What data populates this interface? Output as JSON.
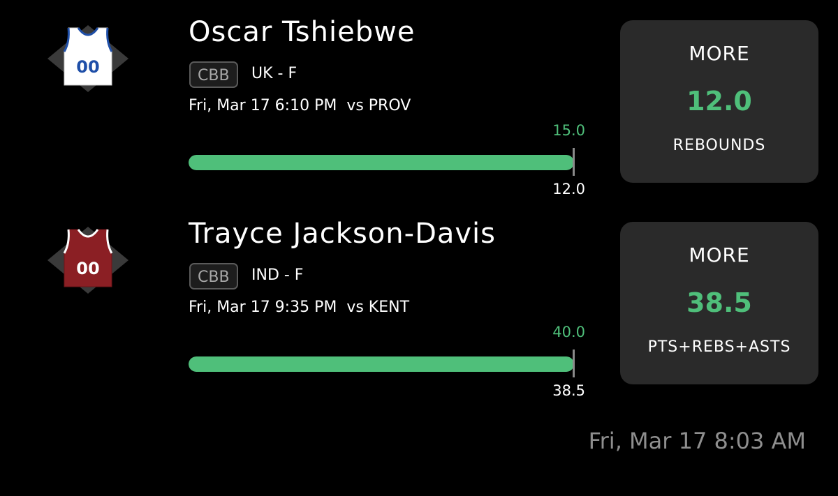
{
  "picks": [
    {
      "player_name": "Oscar Tshiebwe",
      "league": "CBB",
      "team_position": "UK - F",
      "game_info": "Fri, Mar 17 6:10 PM  vs PROV",
      "bar_top_value": "15.0",
      "bar_bottom_value": "12.0",
      "progress_fraction": 1.0,
      "jersey": {
        "number": "00",
        "body_color": "#ffffff",
        "trim_color": "#1f4fa8",
        "number_color": "#1f4fa8"
      },
      "card": {
        "direction": "MORE",
        "line": "12.0",
        "stat": "REBOUNDS"
      }
    },
    {
      "player_name": "Trayce Jackson-Davis",
      "league": "CBB",
      "team_position": "IND - F",
      "game_info": "Fri, Mar 17 9:35 PM  vs KENT",
      "bar_top_value": "40.0",
      "bar_bottom_value": "38.5",
      "progress_fraction": 1.0,
      "jersey": {
        "number": "00",
        "body_color": "#8b1f24",
        "trim_color": "#ffffff",
        "number_color": "#ffffff"
      },
      "card": {
        "direction": "MORE",
        "line": "38.5",
        "stat": "PTS+REBS+ASTS"
      }
    }
  ],
  "timestamp": "Fri, Mar 17 8:03 AM",
  "colors": {
    "accent_green": "#4fbf7a",
    "card_bg": "#2a2a2a",
    "muted_text": "#8e8e8e"
  },
  "icons": {
    "jersey": "basketball-jersey-icon"
  }
}
